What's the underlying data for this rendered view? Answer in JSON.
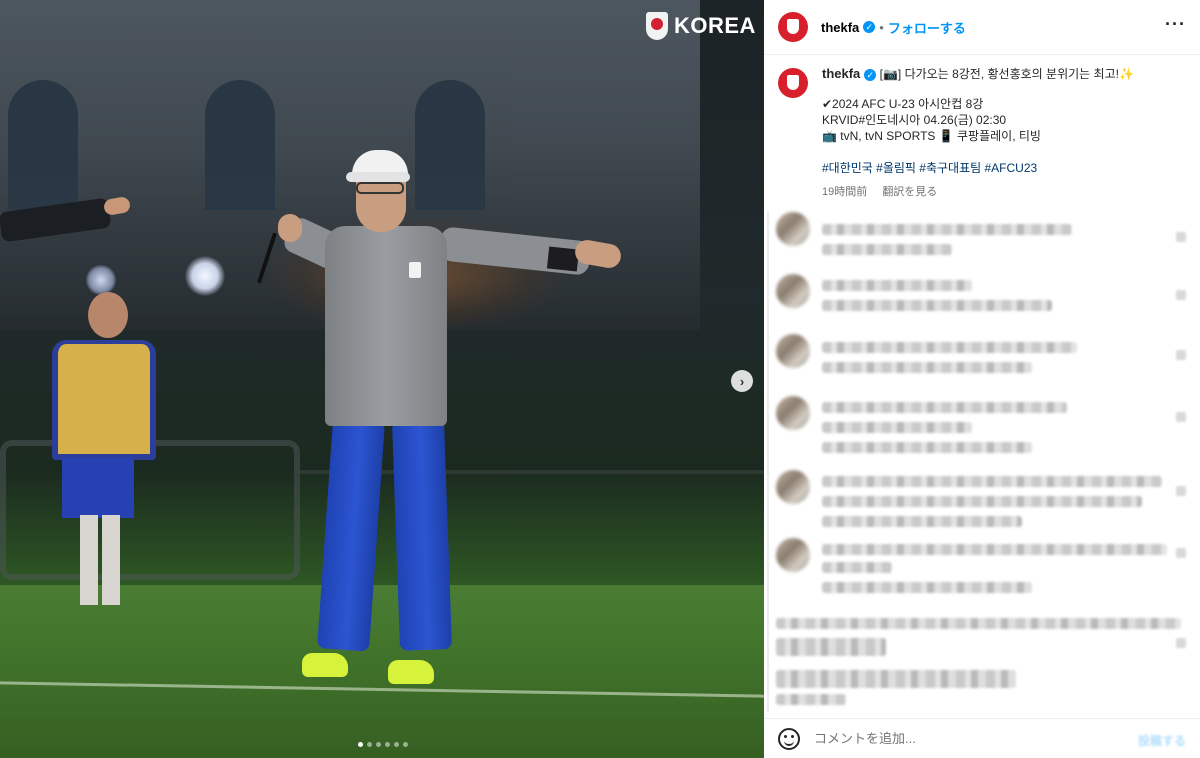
{
  "photo": {
    "logo_text": "KOREA",
    "carousel_total": 6,
    "carousel_active": 1
  },
  "header": {
    "username": "thekfa",
    "separator": "•",
    "follow_label": "フォローする",
    "more_label": "···"
  },
  "caption": {
    "username": "thekfa",
    "line1": "[📷] 다가오는 8강전, 황선홍호의 분위기는 최고!✨",
    "line2": "✔2024 AFC U-23 아시안컵 8강",
    "line3": "KRVID#인도네시아 04.26(금) 02:30",
    "line4": "📺 tvN, tvN SPORTS 📱 쿠팡플레이, 티빙",
    "hashtags": "#대한민국 #올림픽 #축구대표팀 #AFCU23",
    "time_ago": "19時間前",
    "see_translation": "翻訳を見る"
  },
  "footer": {
    "comment_placeholder": "コメントを追加...",
    "post_label": "投稿する"
  },
  "colors": {
    "accent": "#0095f6",
    "brand_red": "#d8202c"
  }
}
